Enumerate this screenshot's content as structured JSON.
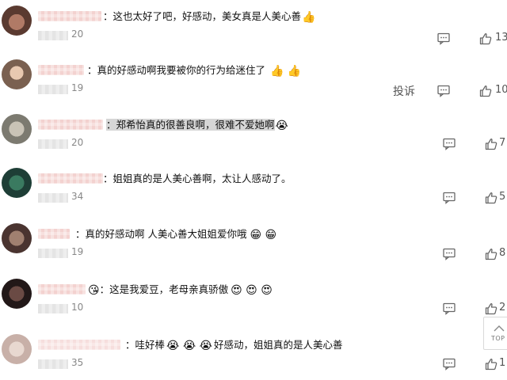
{
  "comments": [
    {
      "text": "：这也太好了吧，好感动，美女真是人美心善",
      "emoji": "👍",
      "date_suffix": "20",
      "likes": "13"
    },
    {
      "text": "：真的好感动啊我要被你的行为给迷住了",
      "emoji": "👍 👍",
      "date_suffix": "19",
      "likes": "10"
    },
    {
      "text_highlight": "：郑希怡真的很善良啊，很难不爱她啊",
      "emoji": "😭",
      "date_suffix": "20",
      "likes": "7"
    },
    {
      "text": "：姐姐真的是人美心善啊，太让人感动了。",
      "date_suffix": "34",
      "likes": "5"
    },
    {
      "text": "：真的好感动啊 人美心善大姐姐爱你哦",
      "emoji": "😁 😁",
      "date_suffix": "19",
      "likes": "8"
    },
    {
      "text": "：这是我爱豆，老母亲真骄傲",
      "emoji_pre": "😘",
      "emoji": "😍 😍 😍",
      "date_suffix": "10",
      "likes": "2"
    },
    {
      "text_pre": "：哇好棒",
      "emoji_mid": "😭 😭 😭",
      "text": "好感动，姐姐真的是人美心善",
      "date_suffix": "35",
      "likes": "1"
    }
  ],
  "report_label": "投诉",
  "scroll_top_label": "TOP",
  "colors": {
    "text": "#111111",
    "muted": "#888888",
    "icon": "#666666",
    "highlight": "#d6d6d6"
  },
  "icons": [
    "comment-bubble-icon",
    "thumbs-up-icon",
    "arrow-up-icon"
  ]
}
